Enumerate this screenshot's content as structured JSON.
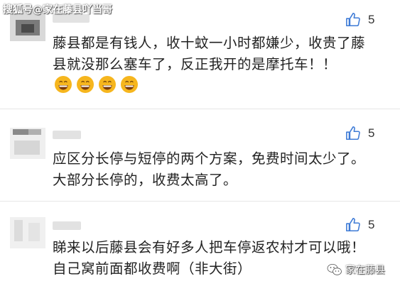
{
  "watermark": "搜狐号@家在藤县吖当哥",
  "comments": [
    {
      "likes": "5",
      "text": "藤县都是有钱人，收十蚊一小时都嫌少，收贵了藤县就没那么塞车了，反正我开的是摩托车！！",
      "emoji_icon": "grinning-face-icon",
      "emoji_count": 4
    },
    {
      "likes": "5",
      "text": "应区分长停与短停的两个方案，免费时间太少了。大部分长停的，收费太高了。"
    },
    {
      "likes": "5",
      "text": "睇来以后藤县会有好多人把车停返农村才可以哦！自己窝前面都收费啊（非大街）"
    }
  ],
  "brand": {
    "label": "家在藤县",
    "icon": "wechat-icon"
  },
  "colors": {
    "like": "#3e7bd6",
    "emoji": "#f6b61e",
    "text": "#222222"
  }
}
